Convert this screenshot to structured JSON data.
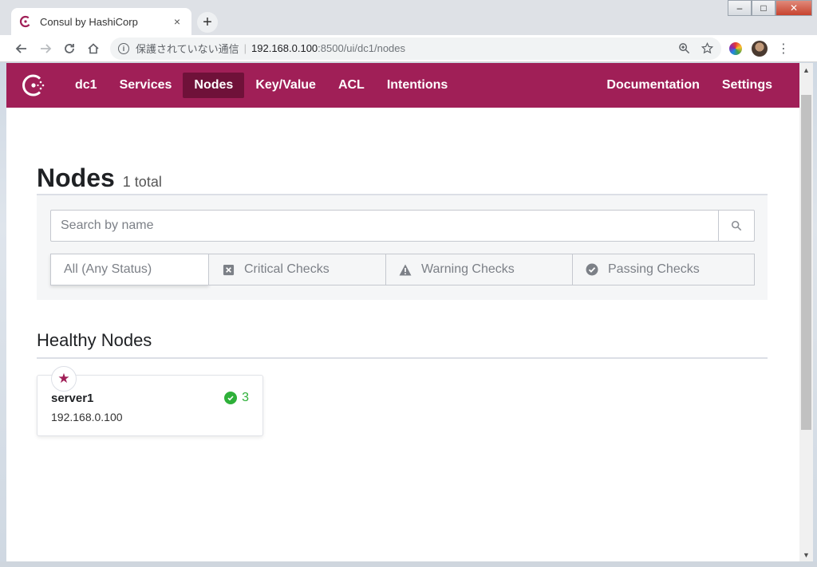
{
  "browser": {
    "tab_title": "Consul by HashiCorp",
    "tab_close": "×",
    "new_tab": "+",
    "address": {
      "insecure_label": "保護されていない通信",
      "separator": "|",
      "host": "192.168.0.100",
      "path": ":8500/ui/dc1/nodes"
    },
    "window_buttons": [
      "–",
      "□",
      "✕"
    ]
  },
  "colors": {
    "brand": "#a01f57",
    "nav_active": "#6f1139",
    "passing": "#2eb039"
  },
  "nav": {
    "datacenter": "dc1",
    "items": [
      {
        "label": "Services",
        "active": false
      },
      {
        "label": "Nodes",
        "active": true
      },
      {
        "label": "Key/Value",
        "active": false
      },
      {
        "label": "ACL",
        "active": false
      },
      {
        "label": "Intentions",
        "active": false
      }
    ],
    "right": [
      {
        "label": "Documentation"
      },
      {
        "label": "Settings"
      }
    ]
  },
  "page": {
    "title": "Nodes",
    "count": "1 total",
    "search_placeholder": "Search by name",
    "status_filters": [
      {
        "label": "All (Any Status)",
        "icon": "none",
        "selected": true
      },
      {
        "label": "Critical Checks",
        "icon": "critical-icon",
        "selected": false
      },
      {
        "label": "Warning Checks",
        "icon": "warning-icon",
        "selected": false
      },
      {
        "label": "Passing Checks",
        "icon": "passing-icon",
        "selected": false
      }
    ],
    "section_title": "Healthy Nodes",
    "nodes": [
      {
        "name": "server1",
        "address": "192.168.0.100",
        "passing_count": "3",
        "leader": true
      }
    ]
  }
}
